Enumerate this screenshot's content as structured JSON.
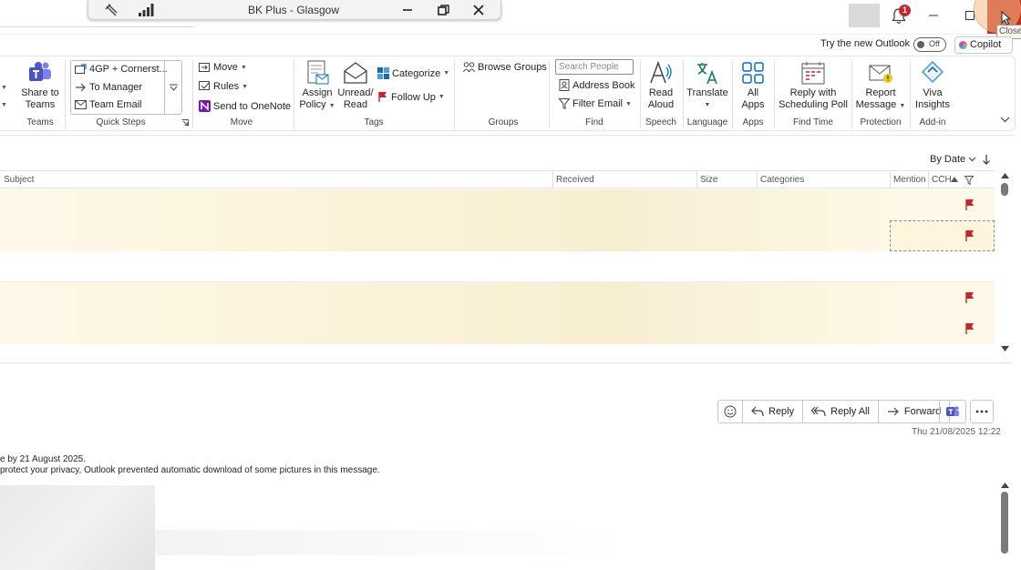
{
  "remote_bar": {
    "title": "BK Plus - Glasgow"
  },
  "window": {
    "notification_count": "1",
    "close_tooltip": "Close"
  },
  "new_outlook": {
    "label": "Try the new Outlook",
    "toggle_state": "Off"
  },
  "copilot": {
    "label": "Copilot"
  },
  "ribbon": {
    "teams": {
      "share_line1": "Share to",
      "share_line2": "Teams",
      "group": "Teams"
    },
    "quick_steps": {
      "items": [
        "4GP + Cornerst...",
        "To Manager",
        "Team Email"
      ],
      "group": "Quick Steps"
    },
    "move": {
      "move": "Move",
      "rules": "Rules",
      "onenote": "Send to OneNote",
      "group": "Move"
    },
    "tags": {
      "assign_line1": "Assign",
      "assign_line2": "Policy",
      "unread_line1": "Unread/",
      "unread_line2": "Read",
      "categorize": "Categorize",
      "follow_up": "Follow Up",
      "group": "Tags"
    },
    "groups": {
      "browse": "Browse Groups",
      "group": "Groups"
    },
    "find": {
      "search_placeholder": "Search People",
      "address_book": "Address Book",
      "filter_email": "Filter Email",
      "group": "Find"
    },
    "speech": {
      "line1": "Read",
      "line2": "Aloud",
      "group": "Speech"
    },
    "language": {
      "translate": "Translate",
      "group": "Language"
    },
    "apps": {
      "line1": "All",
      "line2": "Apps",
      "group": "Apps"
    },
    "find_time": {
      "line1": "Reply with",
      "line2": "Scheduling Poll",
      "group": "Find Time"
    },
    "protection": {
      "line1": "Report",
      "line2": "Message",
      "group": "Protection"
    },
    "addin": {
      "line1": "Viva",
      "line2": "Insights",
      "group": "Add-in"
    }
  },
  "message_list": {
    "sort_label": "By Date",
    "columns": {
      "subject": "Subject",
      "received": "Received",
      "size": "Size",
      "categories": "Categories",
      "mention": "Mention",
      "cch": "CCH"
    },
    "rows": [
      {
        "flagged": true,
        "selected": false,
        "blurred": true
      },
      {
        "flagged": true,
        "selected": true,
        "blurred": true
      },
      {
        "flagged": false,
        "selected": false,
        "blurred": false
      },
      {
        "flagged": true,
        "selected": false,
        "blurred": true
      },
      {
        "flagged": true,
        "selected": false,
        "blurred": true
      }
    ]
  },
  "reading_pane": {
    "actions": {
      "reply": "Reply",
      "reply_all": "Reply All",
      "forward": "Forward"
    },
    "date": "Thu 21/08/2025 12:22",
    "body_line1": "e by 21 August 2025.",
    "body_line2": "protect your privacy, Outlook prevented automatic download of some pictures in this message."
  },
  "colors": {
    "accent": "#0f6cbd",
    "flag": "#c4262e",
    "close": "#c42b1c",
    "row_highlight": "#fdf6dc"
  }
}
